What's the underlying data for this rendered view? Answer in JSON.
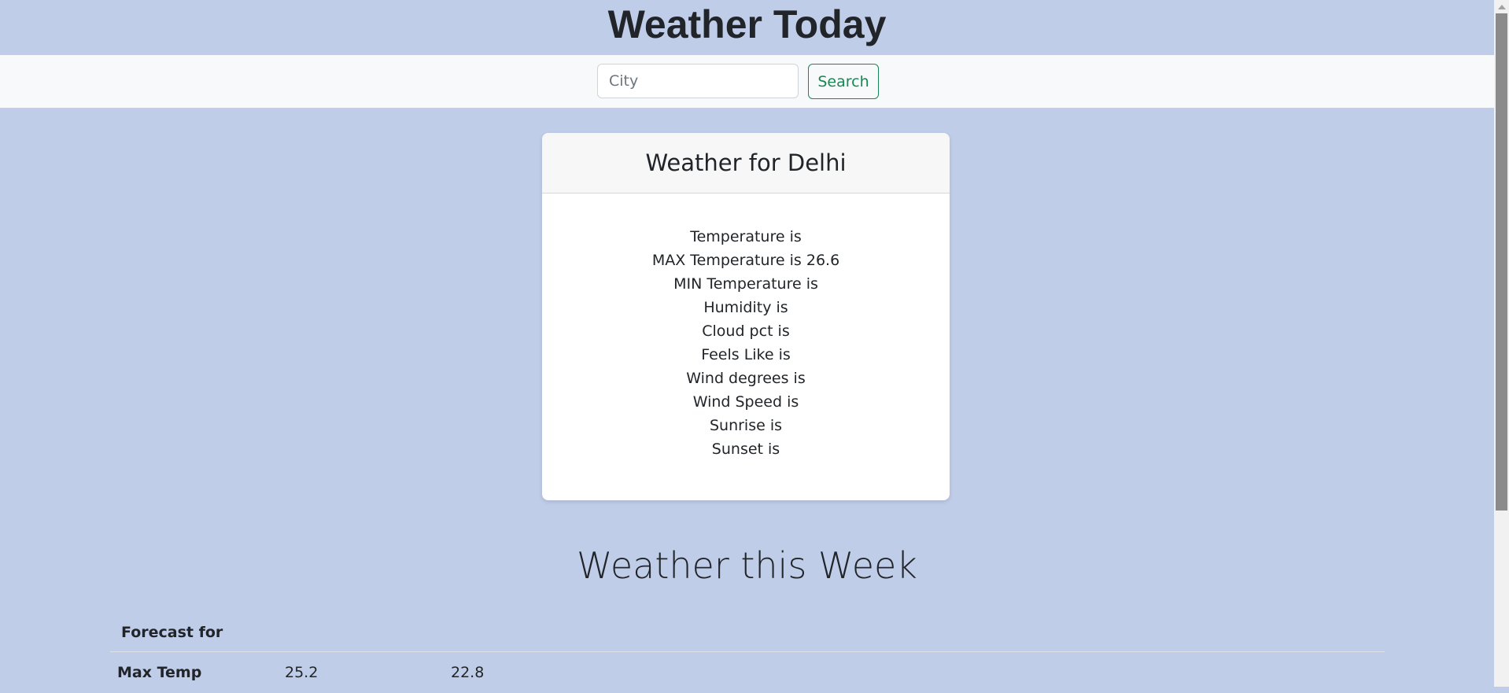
{
  "header": {
    "title": "Weather Today"
  },
  "search": {
    "placeholder": "City",
    "value": "",
    "button_label": "Search"
  },
  "current": {
    "heading": "Weather for Delhi",
    "stats": [
      "Temperature is",
      "MAX Temperature is 26.6",
      "MIN Temperature is",
      "Humidity is",
      "Cloud pct is",
      "Feels Like is",
      "Wind degrees is",
      "Wind Speed is",
      "Sunrise is",
      "Sunset is"
    ]
  },
  "week": {
    "title": "Weather this Week",
    "forecast_header": "Forecast for",
    "rows": [
      {
        "label": "Max Temp",
        "values": [
          "25.2",
          "22.8"
        ]
      }
    ]
  },
  "colors": {
    "background": "#c0cde9",
    "search_bar": "#f8f9fa",
    "accent_green": "#198754",
    "card": "#ffffff"
  }
}
